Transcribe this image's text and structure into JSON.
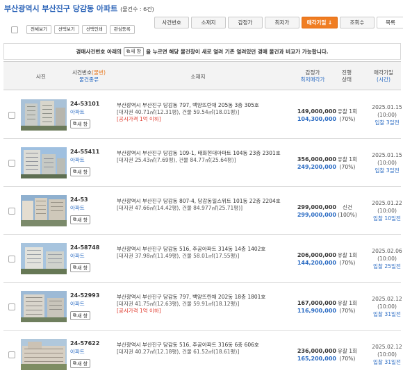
{
  "header": {
    "title": "부산광역시 부산진구 당감동 아파트",
    "count_label": "(물건수 : 6건)"
  },
  "sort_buttons": [
    "사건번호",
    "소재지",
    "감정가",
    "최저가",
    "매각기일 ↓",
    "조회수",
    "목록"
  ],
  "toolbar": [
    "전체보기",
    "선택보기",
    "선택인쇄",
    "관심등록"
  ],
  "notice": {
    "prefix": "경매사건번호 아래의",
    "button": "새 창",
    "suffix": "을 누르면 해당 물건창이 새로 열려 기존 열려있던 경매 물건과 비교가 가능합니다."
  },
  "columns": {
    "photo": "사진",
    "caseno": "사건번호",
    "caseno_tag": "(물번)",
    "ctype": "물건종류",
    "location": "소재지",
    "appraisal": "감정가",
    "min_price": "최저매각가",
    "progress": "진행",
    "status": "상태",
    "sale_date": "매각기일",
    "time": "(시간)"
  },
  "new_window_label": "새 창",
  "colors": {
    "title": "#2c64b8",
    "link": "#2a6bc3",
    "active_sort": "#f07d22",
    "warning": "#e03b2e"
  },
  "rows": [
    {
      "caseno": "24-53101",
      "type": "아파트",
      "address": "부산광역시 부산진구 당감동 797, 백양뜨란채 205동 3층 305호",
      "size": "[대지권 40.71㎡(12.31평), 건물 59.54㎡(18.01평)]",
      "note": "[공시가격 1억 이하]",
      "appraisal": "149,000,000",
      "min_price": "104,300,000",
      "status": "유찰 1회",
      "pct": "(70%)",
      "date": "2025.01.15",
      "time": "(10:00)",
      "dday": "입찰 3일전"
    },
    {
      "caseno": "24-55411",
      "type": "아파트",
      "address": "부산광역시 부산진구 당감동 109-1, 태화현대아파트 104동 23층 2301호",
      "size": "[대지권 25.43㎡(7.69평), 건물 84.77㎡(25.64평)]",
      "note": "",
      "appraisal": "356,000,000",
      "min_price": "249,200,000",
      "status": "유찰 1회",
      "pct": "(70%)",
      "date": "2025.01.15",
      "time": "(10:00)",
      "dday": "입찰 3일전"
    },
    {
      "caseno": "24-53",
      "type": "아파트",
      "address": "부산광역시 부산진구 당감동 807-4, 당감동일스위트 101동 22층 2204호",
      "size": "[대지권 47.66㎡(14.42평), 건물 84.977㎡(25.71평)]",
      "note": "",
      "appraisal": "299,000,000",
      "min_price": "299,000,000",
      "status": "신건",
      "pct": "(100%)",
      "date": "2025.01.22",
      "time": "(10:00)",
      "dday": "입찰 10일전"
    },
    {
      "caseno": "24-58748",
      "type": "아파트",
      "address": "부산광역시 부산진구 당감동 516, 주공아파트 314동 14층 1402호",
      "size": "[대지권 37.98㎡(11.49평), 건물 58.01㎡(17.55평)]",
      "note": "",
      "appraisal": "206,000,000",
      "min_price": "144,200,000",
      "status": "유찰 1회",
      "pct": "(70%)",
      "date": "2025.02.06",
      "time": "(10:00)",
      "dday": "입찰 25일전"
    },
    {
      "caseno": "24-52993",
      "type": "아파트",
      "address": "부산광역시 부산진구 당감동 797, 백양뜨란채 202동 18층 1801호",
      "size": "[대지권 41.75㎡(12.63평), 건물 59.91㎡(18.12평)]",
      "note": "[공시가격 1억 이하]",
      "appraisal": "167,000,000",
      "min_price": "116,900,000",
      "status": "유찰 1회",
      "pct": "(70%)",
      "date": "2025.02.12",
      "time": "(10:00)",
      "dday": "입찰 31일전"
    },
    {
      "caseno": "24-57622",
      "type": "아파트",
      "address": "부산광역시 부산진구 당감동 516, 주공아파트 316동 6층 606호",
      "size": "[대지권 40.27㎡(12.18평), 건물 61.52㎡(18.61평)]",
      "note": "",
      "appraisal": "236,000,000",
      "min_price": "165,200,000",
      "status": "유찰 1회",
      "pct": "(70%)",
      "date": "2025.02.12",
      "time": "(10:00)",
      "dday": "입찰 31일전"
    }
  ]
}
